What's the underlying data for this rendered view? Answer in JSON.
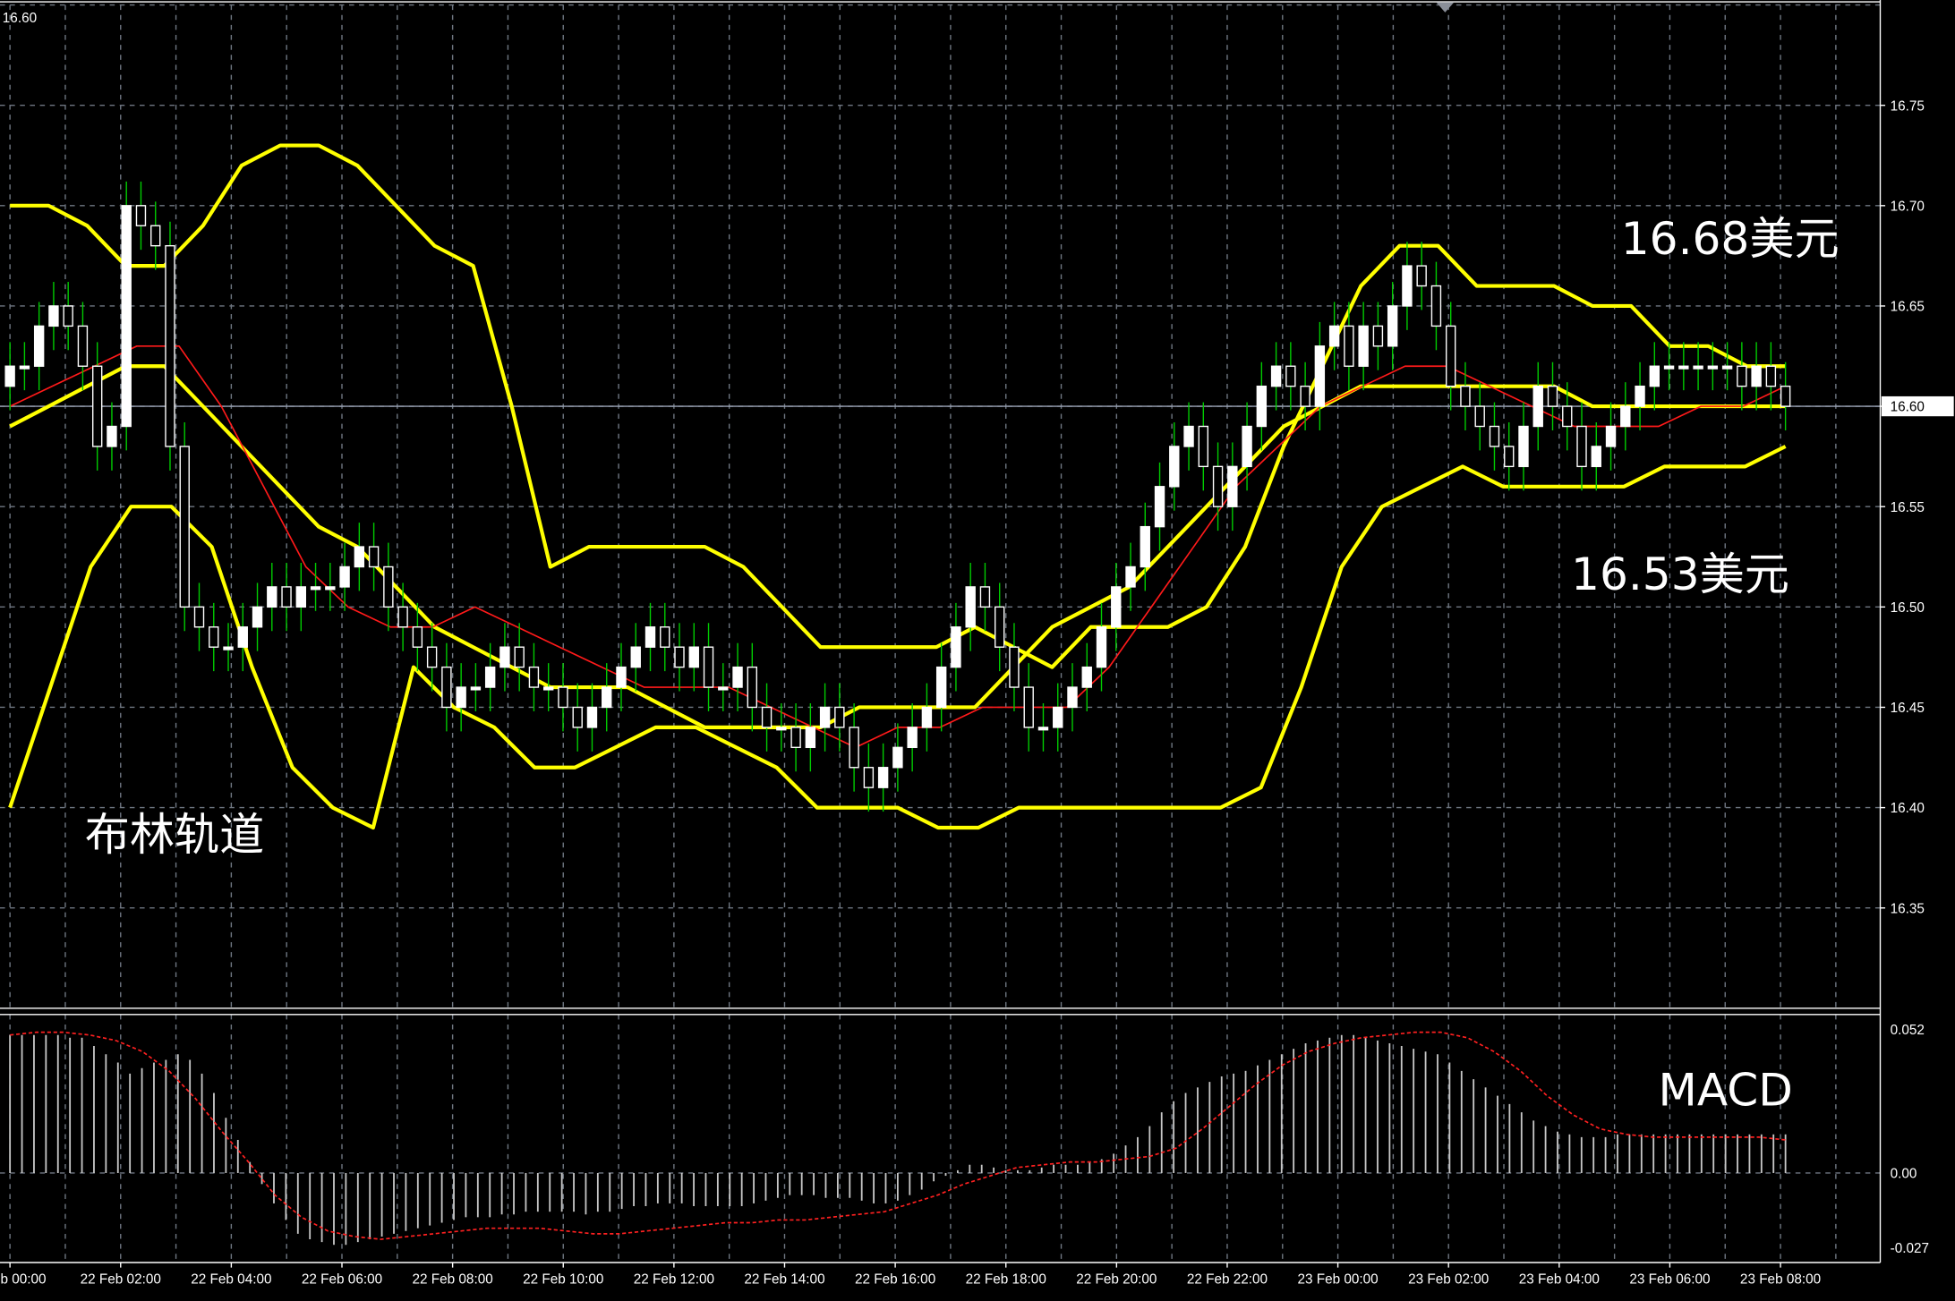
{
  "colors": {
    "background": "#000000",
    "grid": "#6f7782",
    "axis": "#ffffff",
    "candle_body": "#ffffff",
    "candle_wick": "#00cc00",
    "bollinger": "#ffff00",
    "moving_average": "#ff1a1a",
    "macd_histogram": "#c8c8c8",
    "macd_signal": "#ff2020",
    "current_price_line": "#9aa3b5"
  },
  "annotations": {
    "upper_price": "16.68美元",
    "lower_price": "16.53美元",
    "bollinger_label": "布林轨道",
    "macd_label": "MACD"
  },
  "top_left_value": "16.60",
  "current_price_label": "16.60",
  "chart_data": [
    {
      "type": "candlestick",
      "title": "",
      "ylim": [
        16.3,
        16.8
      ],
      "y_ticks": [
        "16.75",
        "16.70",
        "16.65",
        "16.60",
        "16.55",
        "16.50",
        "16.45",
        "16.40",
        "16.35"
      ],
      "x_ticks": [
        "22 Feb 00:00",
        "22 Feb 02:00",
        "22 Feb 04:00",
        "22 Feb 06:00",
        "22 Feb 08:00",
        "22 Feb 10:00",
        "22 Feb 12:00",
        "22 Feb 14:00",
        "22 Feb 16:00",
        "22 Feb 18:00",
        "22 Feb 20:00",
        "22 Feb 22:00",
        "23 Feb 00:00",
        "23 Feb 02:00",
        "23 Feb 04:00",
        "23 Feb 06:00",
        "23 Feb 08:00"
      ],
      "current_price": 16.6,
      "close": [
        16.62,
        16.62,
        16.64,
        16.65,
        16.64,
        16.62,
        16.58,
        16.59,
        16.7,
        16.69,
        16.68,
        16.58,
        16.5,
        16.49,
        16.48,
        16.48,
        16.49,
        16.5,
        16.51,
        16.5,
        16.51,
        16.51,
        16.51,
        16.52,
        16.53,
        16.52,
        16.5,
        16.49,
        16.48,
        16.47,
        16.45,
        16.46,
        16.46,
        16.47,
        16.48,
        16.47,
        16.46,
        16.46,
        16.45,
        16.44,
        16.45,
        16.46,
        16.47,
        16.48,
        16.49,
        16.48,
        16.47,
        16.48,
        16.46,
        16.46,
        16.47,
        16.45,
        16.44,
        16.44,
        16.43,
        16.44,
        16.45,
        16.44,
        16.42,
        16.41,
        16.42,
        16.43,
        16.44,
        16.45,
        16.47,
        16.49,
        16.51,
        16.5,
        16.48,
        16.46,
        16.44,
        16.44,
        16.45,
        16.46,
        16.47,
        16.49,
        16.51,
        16.52,
        16.54,
        16.56,
        16.58,
        16.59,
        16.57,
        16.55,
        16.57,
        16.59,
        16.61,
        16.62,
        16.61,
        16.6,
        16.63,
        16.64,
        16.62,
        16.64,
        16.63,
        16.65,
        16.67,
        16.66,
        16.64,
        16.61,
        16.6,
        16.59,
        16.58,
        16.57,
        16.59,
        16.61,
        16.6,
        16.59,
        16.57,
        16.58,
        16.59,
        16.6,
        16.61,
        16.62,
        16.62,
        16.62,
        16.62,
        16.62,
        16.62,
        16.61,
        16.62,
        16.61,
        16.6
      ],
      "bollinger_upper": [
        16.7,
        16.7,
        16.69,
        16.67,
        16.67,
        16.69,
        16.72,
        16.73,
        16.73,
        16.72,
        16.7,
        16.68,
        16.67,
        16.6,
        16.52,
        16.53,
        16.53,
        16.53,
        16.53,
        16.52,
        16.5,
        16.48,
        16.48,
        16.48,
        16.48,
        16.49,
        16.48,
        16.47,
        16.49,
        16.49,
        16.49,
        16.5,
        16.53,
        16.58,
        16.62,
        16.66,
        16.68,
        16.68,
        16.66,
        16.66,
        16.66,
        16.65,
        16.65,
        16.63,
        16.63,
        16.62,
        16.62
      ],
      "bollinger_middle": [
        16.59,
        16.6,
        16.61,
        16.62,
        16.62,
        16.6,
        16.58,
        16.56,
        16.54,
        16.53,
        16.51,
        16.49,
        16.48,
        16.47,
        16.46,
        16.46,
        16.46,
        16.45,
        16.44,
        16.44,
        16.44,
        16.44,
        16.45,
        16.45,
        16.45,
        16.45,
        16.47,
        16.49,
        16.5,
        16.51,
        16.53,
        16.55,
        16.57,
        16.59,
        16.6,
        16.61,
        16.61,
        16.61,
        16.61,
        16.61,
        16.61,
        16.6,
        16.6,
        16.6,
        16.6,
        16.6,
        16.6
      ],
      "bollinger_lower": [
        16.4,
        16.46,
        16.52,
        16.55,
        16.55,
        16.53,
        16.47,
        16.42,
        16.4,
        16.39,
        16.47,
        16.45,
        16.44,
        16.42,
        16.42,
        16.43,
        16.44,
        16.44,
        16.43,
        16.42,
        16.4,
        16.4,
        16.4,
        16.39,
        16.39,
        16.4,
        16.4,
        16.4,
        16.4,
        16.4,
        16.4,
        16.41,
        16.46,
        16.52,
        16.55,
        16.56,
        16.57,
        16.56,
        16.56,
        16.56,
        16.56,
        16.57,
        16.57,
        16.57,
        16.58
      ],
      "moving_average": [
        16.6,
        16.61,
        16.62,
        16.63,
        16.63,
        16.6,
        16.56,
        16.52,
        16.5,
        16.49,
        16.49,
        16.5,
        16.49,
        16.48,
        16.47,
        16.46,
        16.46,
        16.46,
        16.45,
        16.44,
        16.43,
        16.44,
        16.44,
        16.45,
        16.45,
        16.45,
        16.47,
        16.5,
        16.53,
        16.56,
        16.58,
        16.6,
        16.61,
        16.62,
        16.62,
        16.61,
        16.6,
        16.59,
        16.59,
        16.59,
        16.6,
        16.6,
        16.61
      ]
    },
    {
      "type": "bar",
      "title": "MACD",
      "ylim": [
        -0.027,
        0.052
      ],
      "y_ticks": [
        "0.052",
        "0.00",
        "-0.027"
      ],
      "histogram": [
        0.05,
        0.05,
        0.05,
        0.05,
        0.05,
        0.049,
        0.049,
        0.046,
        0.043,
        0.04,
        0.036,
        0.038,
        0.04,
        0.041,
        0.043,
        0.041,
        0.036,
        0.029,
        0.02,
        0.012,
        0.004,
        -0.004,
        -0.011,
        -0.017,
        -0.022,
        -0.024,
        -0.025,
        -0.026,
        -0.026,
        -0.025,
        -0.024,
        -0.023,
        -0.022,
        -0.021,
        -0.02,
        -0.019,
        -0.018,
        -0.017,
        -0.016,
        -0.016,
        -0.016,
        -0.015,
        -0.015,
        -0.014,
        -0.014,
        -0.014,
        -0.014,
        -0.014,
        -0.015,
        -0.014,
        -0.014,
        -0.013,
        -0.012,
        -0.012,
        -0.011,
        -0.011,
        -0.011,
        -0.012,
        -0.012,
        -0.012,
        -0.012,
        -0.012,
        -0.011,
        -0.01,
        -0.009,
        -0.008,
        -0.008,
        -0.008,
        -0.009,
        -0.009,
        -0.009,
        -0.01,
        -0.011,
        -0.011,
        -0.01,
        -0.008,
        -0.006,
        -0.003,
        -0.001,
        0.001,
        0.003,
        0.003,
        0.002,
        0.001,
        0.001,
        0.001,
        0.002,
        0.003,
        0.003,
        0.003,
        0.004,
        0.005,
        0.007,
        0.01,
        0.013,
        0.017,
        0.022,
        0.026,
        0.029,
        0.031,
        0.033,
        0.035,
        0.036,
        0.037,
        0.039,
        0.041,
        0.043,
        0.045,
        0.047,
        0.048,
        0.049,
        0.05,
        0.05,
        0.049,
        0.048,
        0.047,
        0.046,
        0.045,
        0.044,
        0.043,
        0.04,
        0.037,
        0.034,
        0.031,
        0.028,
        0.025,
        0.022,
        0.019,
        0.017,
        0.015,
        0.014,
        0.013,
        0.013,
        0.013,
        0.014,
        0.014,
        0.014,
        0.014,
        0.014,
        0.014,
        0.014,
        0.014,
        0.014,
        0.014,
        0.014,
        0.014,
        0.014,
        0.014,
        0.014
      ],
      "signal": [
        0.05,
        0.051,
        0.051,
        0.05,
        0.048,
        0.044,
        0.037,
        0.027,
        0.015,
        0.004,
        -0.008,
        -0.016,
        -0.021,
        -0.023,
        -0.024,
        -0.023,
        -0.022,
        -0.021,
        -0.02,
        -0.02,
        -0.02,
        -0.021,
        -0.022,
        -0.022,
        -0.021,
        -0.02,
        -0.019,
        -0.018,
        -0.018,
        -0.017,
        -0.017,
        -0.016,
        -0.015,
        -0.014,
        -0.011,
        -0.008,
        -0.004,
        -0.001,
        0.002,
        0.003,
        0.004,
        0.004,
        0.005,
        0.006,
        0.009,
        0.016,
        0.024,
        0.032,
        0.039,
        0.044,
        0.047,
        0.049,
        0.05,
        0.051,
        0.051,
        0.049,
        0.044,
        0.037,
        0.028,
        0.021,
        0.016,
        0.014,
        0.013,
        0.013,
        0.013,
        0.013,
        0.013,
        0.012
      ]
    }
  ]
}
